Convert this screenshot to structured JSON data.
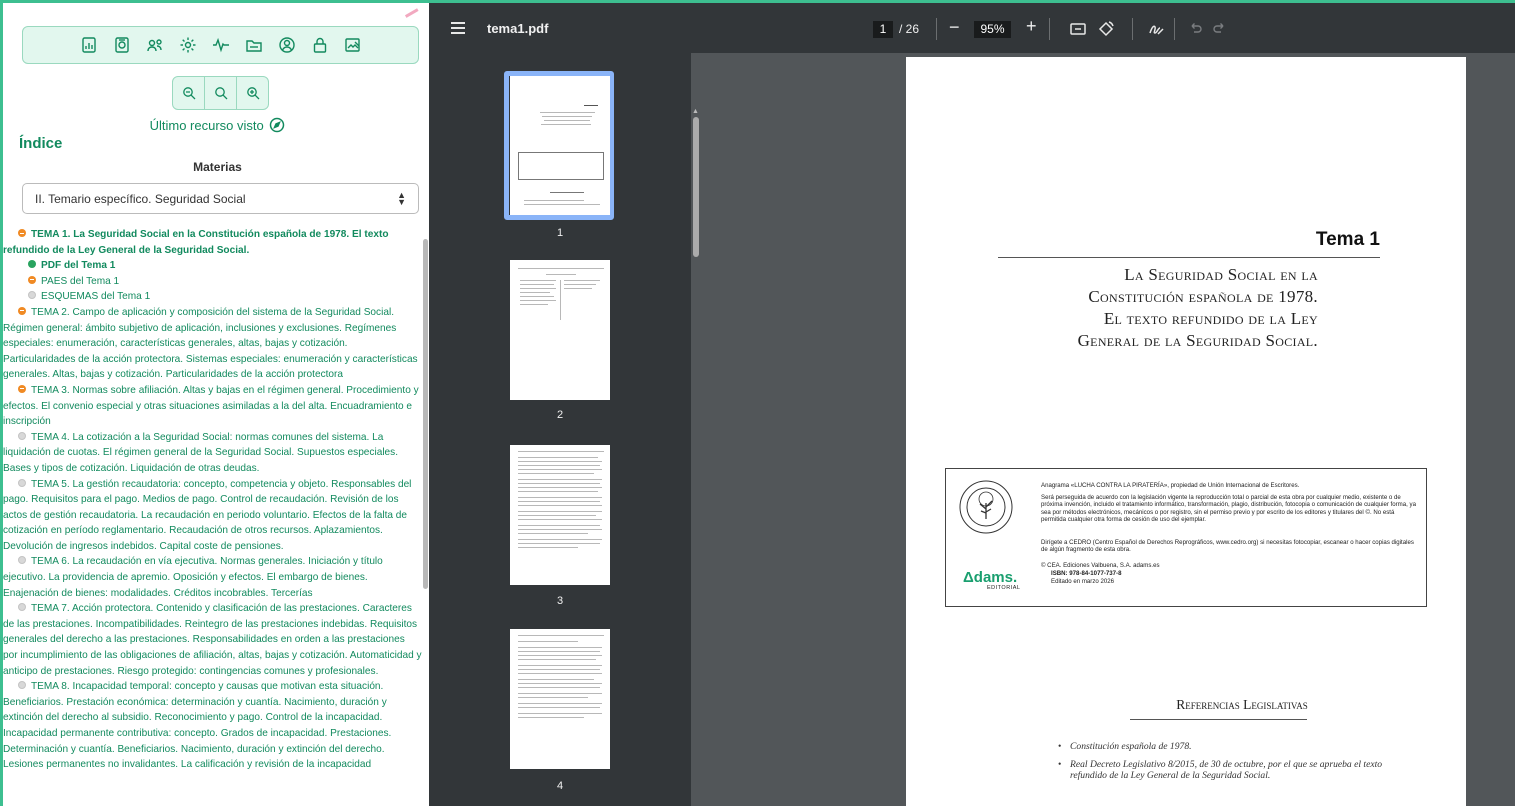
{
  "sidebar": {
    "last_resource": "Último recurso visto",
    "index_title": "Índice",
    "materias_label": "Materias",
    "selected_materia": "II. Temario específico. Seguridad Social",
    "topics": [
      {
        "status": "orange",
        "bold": true,
        "text": "TEMA 1. La Seguridad Social en la Constitución española de 1978. El texto refundido de la Ley General de la Seguridad Social."
      },
      {
        "status": "green",
        "bold": true,
        "sub": true,
        "text": "PDF del Tema 1"
      },
      {
        "status": "orange",
        "sub": true,
        "text": "PAES del Tema 1"
      },
      {
        "status": "gray",
        "sub": true,
        "text": "ESQUEMAS del Tema 1"
      },
      {
        "status": "orange",
        "text": "TEMA 2. Campo de aplicación y composición del sistema de la Seguridad Social. Régimen general: ámbito subjetivo de aplicación, inclusiones y exclusiones. Regímenes especiales: enumeración, características generales, altas, bajas y cotización. Particularidades de la acción protectora. Sistemas especiales: enumeración y características generales. Altas, bajas y cotización. Particularidades de la acción protectora"
      },
      {
        "status": "orange",
        "text": "TEMA 3. Normas sobre afiliación. Altas y bajas en el régimen general. Procedimiento y efectos. El convenio especial y otras situaciones asimiladas a la del alta. Encuadramiento e inscripción"
      },
      {
        "status": "gray",
        "text": "TEMA 4. La cotización a la Seguridad Social: normas comunes del sistema. La liquidación de cuotas. El régimen general de la Seguridad Social. Supuestos especiales. Bases y tipos de cotización. Liquidación de otras deudas."
      },
      {
        "status": "gray",
        "text": "TEMA 5. La gestión recaudatoria: concepto, competencia y objeto. Responsables del pago. Requisitos para el pago. Medios de pago. Control de recaudación. Revisión de los actos de gestión recaudatoria. La recaudación en periodo voluntario. Efectos de la falta de cotización en período reglamentario. Recaudación de otros recursos. Aplazamientos. Devolución de ingresos indebidos. Capital coste de pensiones."
      },
      {
        "status": "gray",
        "text": "TEMA 6. La recaudación en vía ejecutiva. Normas generales. Iniciación y título ejecutivo. La providencia de apremio. Oposición y efectos. El embargo de bienes. Enajenación de bienes: modalidades. Créditos incobrables. Tercerías"
      },
      {
        "status": "gray",
        "text": "TEMA 7. Acción protectora. Contenido y clasificación de las prestaciones. Caracteres de las prestaciones. Incompatibilidades. Reintegro de las prestaciones indebidas. Requisitos generales del derecho a las prestaciones. Responsabilidades en orden a las prestaciones por incumplimiento de las obligaciones de afiliación, altas, bajas y cotización. Automaticidad y anticipo de prestaciones. Riesgo protegido: contingencias comunes y profesionales."
      },
      {
        "status": "gray",
        "text": "TEMA 8. Incapacidad temporal: concepto y causas que motivan esta situación. Beneficiarios. Prestación económica: determinación y cuantía. Nacimiento, duración y extinción del derecho al subsidio. Reconocimiento y pago. Control de la incapacidad. Incapacidad permanente contributiva: concepto. Grados de incapacidad. Prestaciones. Determinación y cuantía. Beneficiarios. Nacimiento, duración y extinción del derecho. Lesiones permanentes no invalidantes. La calificación y revisión de la incapacidad"
      }
    ]
  },
  "viewer": {
    "file_name": "tema1.pdf",
    "current_page": "1",
    "total_pages": "/ 26",
    "zoom": "95%",
    "zoom_minus": "−",
    "zoom_plus": "+",
    "thumbnail_numbers": [
      "1",
      "2",
      "3",
      "4"
    ]
  },
  "page": {
    "tema_label": "Tema 1",
    "title_lines": [
      "La Seguridad Social en la",
      "Constitución española de 1978.",
      "El texto refundido de la Ley",
      "General de la Seguridad Social."
    ],
    "legal": {
      "line1": "Anagrama «LUCHA CONTRA LA PIRATERÍA», propiedad de Unión Internacional de Escritores.",
      "para1": "Será perseguida de acuerdo con la legislación vigente la reproducción total o parcial de esta obra por cualquier medio, existente o de próxima invención, incluido el tratamiento informático, transformación, plagio, distribución, fotocopia o comunicación de cualquier forma, ya sea por métodos electrónicos, mecánicos o por registro, sin el permiso previo y por escrito de los editores y titulares del ©. No está permitida cualquier otra forma de cesión de uso del ejemplar.",
      "para2": "Dirígete a CEDRO (Centro Español de Derechos Reprográficos, www.cedro.org) si necesitas fotocopiar, escanear o hacer copias digitales de algún fragmento de esta obra.",
      "copyright": "©  CEA. Ediciones Valbuena, S.A.    adams.es",
      "isbn": "ISBN: 978-84-1077-737-8",
      "edited": "Editado en marzo 2026"
    },
    "logo_text": "Δdams.",
    "logo_sub": "EDITORIAL",
    "refs_title": "Referencias Legislativas",
    "refs": [
      "Constitución española de 1978.",
      "Real Decreto Legislativo 8/2015, de 30 de octubre, por el que se aprueba el texto refundido de la Ley General de la Seguridad Social."
    ]
  },
  "colors": {
    "accent": "#3dbf90",
    "text_green": "#128a5e",
    "status_orange": "#f08a24",
    "status_green": "#29a35f",
    "viewer_bg": "#525659",
    "toolbar_bg": "#323639"
  }
}
